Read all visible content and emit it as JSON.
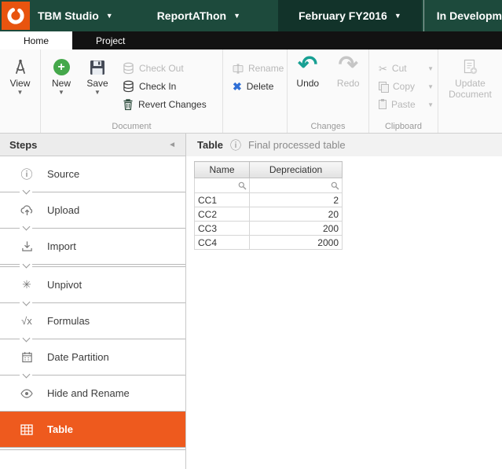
{
  "titlebar": {
    "app": "TBM Studio",
    "project": "ReportAThon",
    "period": "February FY2016",
    "environment": "In Development"
  },
  "tabs": [
    {
      "label": "Home",
      "active": true
    },
    {
      "label": "Project",
      "active": false
    }
  ],
  "ribbon": {
    "view": "View",
    "new": "New",
    "save": "Save",
    "check_out": "Check Out",
    "check_in": "Check In",
    "revert": "Revert Changes",
    "rename": "Rename",
    "delete": "Delete",
    "undo": "Undo",
    "redo": "Redo",
    "cut": "Cut",
    "copy": "Copy",
    "paste": "Paste",
    "update_line1": "Update",
    "update_line2": "Document",
    "groups": {
      "document": "Document",
      "changes": "Changes",
      "clipboard": "Clipboard"
    }
  },
  "steps_panel": {
    "title": "Steps",
    "items": [
      {
        "label": "Source",
        "icon": "info-icon"
      },
      {
        "label": "Upload",
        "icon": "cloud-upload-icon"
      },
      {
        "label": "Import",
        "icon": "import-icon"
      },
      {
        "label": "Unpivot",
        "icon": "unpivot-icon"
      },
      {
        "label": "Formulas",
        "icon": "formula-icon"
      },
      {
        "label": "Date Partition",
        "icon": "calendar-icon"
      },
      {
        "label": "Hide and Rename",
        "icon": "eye-icon"
      },
      {
        "label": "Table",
        "icon": "table-icon",
        "selected": true
      }
    ]
  },
  "main": {
    "title": "Table",
    "subtitle": "Final processed table",
    "table": {
      "columns": [
        "Name",
        "Depreciation"
      ],
      "rows": [
        [
          "CC1",
          "2"
        ],
        [
          "CC2",
          "20"
        ],
        [
          "CC3",
          "200"
        ],
        [
          "CC4",
          "2000"
        ]
      ]
    }
  },
  "colors": {
    "topbar-green": "#1d4a3c",
    "topbar-green-dark": "#12332a",
    "brand-orange": "#e8540f",
    "selected-orange": "#ee5a1e",
    "undo-teal": "#18a093",
    "delete-blue": "#2f6fd6",
    "tabbar-black": "#121212"
  }
}
